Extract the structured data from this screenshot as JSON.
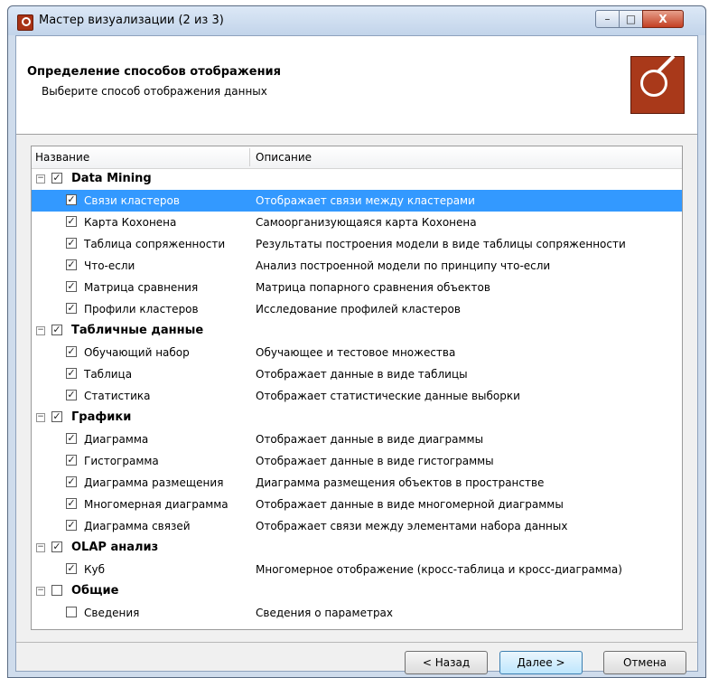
{
  "window": {
    "title": "Мастер визуализации (2 из 3)",
    "controls": {
      "minimize": "–",
      "maximize": "□",
      "close": "X"
    }
  },
  "header": {
    "title": "Определение способов отображения",
    "subtitle": "Выберите способ отображения данных",
    "icon": "wizard-icon"
  },
  "columns": {
    "name": "Название",
    "description": "Описание"
  },
  "groups": [
    {
      "name": "Data Mining",
      "checked": true,
      "expanded": true,
      "items": [
        {
          "name": "Связи кластеров",
          "description": "Отображает связи между кластерами",
          "checked": true,
          "selected": true
        },
        {
          "name": "Карта Кохонена",
          "description": "Самоорганизующаяся карта Кохонена",
          "checked": true
        },
        {
          "name": "Таблица сопряженности",
          "description": "Результаты построения модели в виде таблицы сопряженности",
          "checked": true
        },
        {
          "name": "Что-если",
          "description": "Анализ построенной модели по принципу что-если",
          "checked": true
        },
        {
          "name": "Матрица сравнения",
          "description": "Матрица попарного сравнения объектов",
          "checked": true
        },
        {
          "name": "Профили кластеров",
          "description": "Исследование профилей кластеров",
          "checked": true
        }
      ]
    },
    {
      "name": "Табличные данные",
      "checked": true,
      "expanded": true,
      "items": [
        {
          "name": "Обучающий набор",
          "description": "Обучающее и тестовое множества",
          "checked": true
        },
        {
          "name": "Таблица",
          "description": "Отображает данные в виде таблицы",
          "checked": true
        },
        {
          "name": "Статистика",
          "description": "Отображает статистические данные выборки",
          "checked": true
        }
      ]
    },
    {
      "name": "Графики",
      "checked": true,
      "expanded": true,
      "items": [
        {
          "name": "Диаграмма",
          "description": "Отображает данные в виде диаграммы",
          "checked": true
        },
        {
          "name": "Гистограмма",
          "description": "Отображает данные в виде гистограммы",
          "checked": true
        },
        {
          "name": "Диаграмма размещения",
          "description": "Диаграмма размещения объектов в пространстве",
          "checked": true
        },
        {
          "name": "Многомерная диаграмма",
          "description": "Отображает данные в виде многомерной диаграммы",
          "checked": true
        },
        {
          "name": "Диаграмма связей",
          "description": "Отображает связи между элементами набора данных",
          "checked": true
        }
      ]
    },
    {
      "name": "OLAP анализ",
      "checked": true,
      "expanded": true,
      "items": [
        {
          "name": "Куб",
          "description": "Многомерное отображение (кросс-таблица и кросс-диаграмма)",
          "checked": true
        }
      ]
    },
    {
      "name": "Общие",
      "checked": false,
      "expanded": true,
      "items": [
        {
          "name": "Сведения",
          "description": "Сведения о параметрах",
          "checked": false
        }
      ]
    }
  ],
  "buttons": {
    "back": "< Назад",
    "next": "Далее >",
    "cancel": "Отмена"
  },
  "colors": {
    "selection": "#3399ff",
    "header_bg": "#ffffff",
    "dialog_bg": "#f0f0f0"
  }
}
